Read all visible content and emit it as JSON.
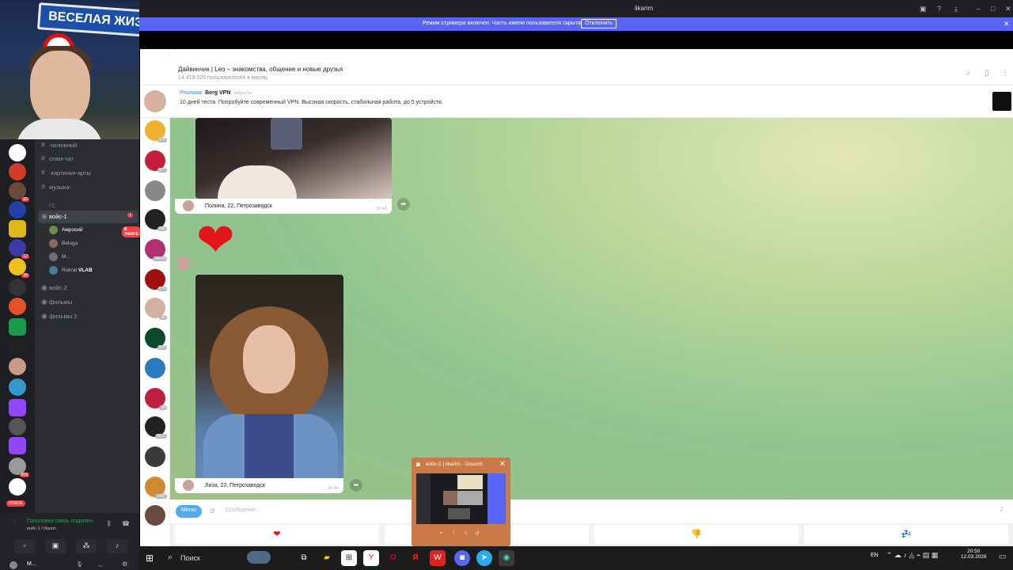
{
  "discord": {
    "window_title": "likarim",
    "streamer_banner": "Режим стримера включен. Часть имени пользователя скрыта.",
    "streamer_button": "Отключить",
    "webcam_sign": "ВЕСЕЛАЯ ЖИЗ",
    "channels": [
      {
        "label": "-основной",
        "active": false
      },
      {
        "label": "спам-чат",
        "active": false
      },
      {
        "label": "-картинки-арты",
        "active": false
      },
      {
        "label": "музыка-",
        "active": false
      }
    ],
    "category": "ГС",
    "voice_channels": [
      {
        "label": "войс-1",
        "active": true,
        "badge": "1"
      },
      {
        "label": "войс-2",
        "active": false
      },
      {
        "label": "фильмы",
        "active": false
      },
      {
        "label": "фильмы 2",
        "active": false
      }
    ],
    "voice_users": [
      {
        "name": "Амросий",
        "live": "В ЭФИРЕ"
      },
      {
        "name": "Beluga",
        "live": ""
      },
      {
        "name": "M...",
        "live": ""
      },
      {
        "name": "Rukrat",
        "tag": "VLAB"
      }
    ],
    "new_badge": "НОВОЕ",
    "voice_status": "Голосовая связь подключ",
    "voice_sub": "войс-1 / likarim",
    "user_name": "M...",
    "guild_badges": [
      "",
      "",
      "60",
      "",
      "22",
      "",
      "",
      "36",
      "",
      "",
      "",
      "",
      "",
      "",
      "",
      "",
      "",
      "808",
      ""
    ],
    "accent": "#5865f2"
  },
  "telegram": {
    "chat_title": "Дайвинчик | Leo – знакомства, общение и новые друзья",
    "chat_subtitle": "14 419 026 пользователей в месяц",
    "ad_label": "Реклама",
    "ad_name": "Berg VPN",
    "ad_close": "закрыть",
    "ad_text": "10 дней теста. Попробуйте современный VPN. Высокая скорость, стабильная работа, до 5 устройств.",
    "messages": [
      {
        "caption": "Полина, 22, Петрозаводск",
        "time": "20:48"
      },
      {
        "emoji": "❤"
      },
      {
        "caption": "Лиза, 22, Петрозаводск",
        "time": "20:49"
      }
    ],
    "menu_button": "Меню",
    "input_placeholder": "Сообщение...",
    "keyboard": [
      "❤",
      "",
      "👎",
      "💤"
    ],
    "left_badges": [
      "375",
      "377",
      "",
      "430",
      "14104",
      "174",
      "32",
      "360",
      "",
      "36",
      "2672",
      "",
      "1430"
    ]
  },
  "popup": {
    "title": "войс-1 | likarim - Discord"
  },
  "taskbar": {
    "search_label": "Поиск",
    "lang": "EN",
    "time": "20:50",
    "date": "12.03.2026"
  }
}
